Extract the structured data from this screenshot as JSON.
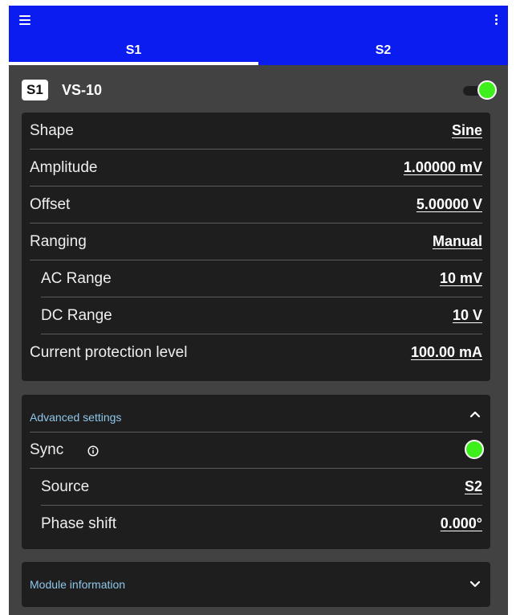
{
  "tabs": [
    {
      "label": "S1",
      "active": true
    },
    {
      "label": "S2",
      "active": false
    }
  ],
  "module": {
    "badge": "S1",
    "name": "VS-10",
    "enabled": true
  },
  "settings": {
    "shape": {
      "label": "Shape",
      "value": "Sine"
    },
    "amplitude": {
      "label": "Amplitude",
      "value": "1.00000 mV"
    },
    "offset": {
      "label": "Offset",
      "value": "5.00000 V"
    },
    "ranging": {
      "label": "Ranging",
      "value": "Manual"
    },
    "ac_range": {
      "label": "AC Range",
      "value": "10 mV"
    },
    "dc_range": {
      "label": "DC Range",
      "value": "10 V"
    },
    "current_protection": {
      "label": "Current protection level",
      "value": "100.00 mA"
    }
  },
  "advanced": {
    "title": "Advanced settings",
    "expanded": true,
    "sync": {
      "label": "Sync",
      "enabled": true
    },
    "source": {
      "label": "Source",
      "value": "S2"
    },
    "phase_shift": {
      "label": "Phase shift",
      "value": "0.000°"
    }
  },
  "module_info": {
    "title": "Module information",
    "expanded": false
  },
  "colors": {
    "topbar": "#0a1cf0",
    "background": "#424242",
    "card": "#1e1e1e",
    "toggle_on": "#3df01c",
    "section_title": "#8fc7ea"
  },
  "icons": {
    "menu": "hamburger-menu-icon",
    "more": "more-vertical-icon",
    "info": "info-icon",
    "expand_less": "chevron-up-icon",
    "expand_more": "chevron-down-icon"
  }
}
